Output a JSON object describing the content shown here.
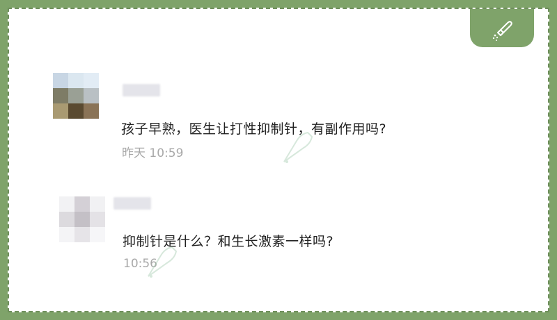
{
  "colors": {
    "frame": "#7fa36a",
    "card_background": "#ffffff",
    "message_text": "#222222",
    "timestamp_text": "#a8a8a8"
  },
  "icons": {
    "corner": "leaf-pen-icon"
  },
  "messages": [
    {
      "text": "孩子早熟，医生让打性抑制针，有副作用吗?",
      "time": "昨天 10:59"
    },
    {
      "text": "抑制针是什么？和生长激素一样吗?",
      "time": "10:56"
    }
  ]
}
